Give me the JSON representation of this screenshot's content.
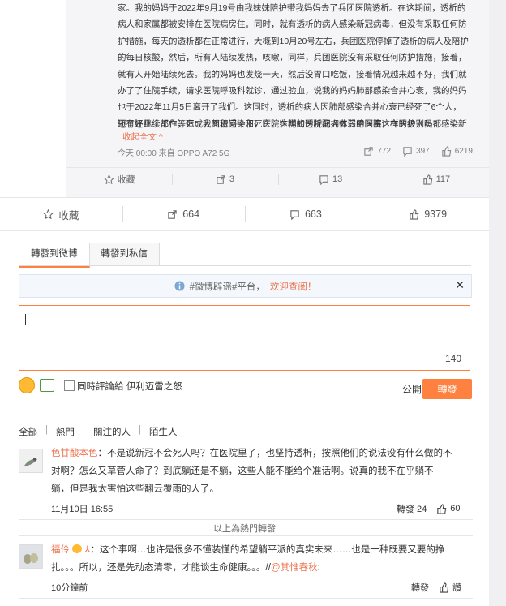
{
  "original_post": {
    "lines": [
      "家。我的妈妈于2022年9月19号由我妹妹陪护带我妈妈去了兵团医院透析。在这期间，透析的",
      "病人和家属都被安排在医院病房住。同时，就有透析的病人感染新冠病毒，但没有采取任何防",
      "护措施，每天的透析都在正常进行，大概到10月20号左右，兵团医院停掉了透析的病人及陪护",
      "的每日核酸，然后，所有人陆续发热，咳嗽，同样，兵团医院没有采取任何防护措施，接着，",
      "就有人开始陆续死去。我的妈妈也发烧一天，然后没胃口吃饭，接着情况越来越不好，我们就",
      "办了了住院手续，请求医院呼吸科就诊，通过验血，说我的妈妈肺部感染合并心衰，我的妈妈",
      "也于2022年11月5日离开了我们。这同时，透析的病人因肺部感染合并心衰已经死了6个人，",
      "还有好几个都在等死。我想请问一下，医院在明知透析病人体弱的同事，在医护人员都感染新",
      "冠了还继续工作，造成大面积感染和死亡，这样的医院配拥有三甲医院这样的级别吗?"
    ],
    "collapse_label": "收起全文 ^",
    "meta": "今天 00:00 来自 OPPO A72 5G",
    "repost_count": "772",
    "comment_count": "397",
    "like_count": "6219"
  },
  "inner_actions": {
    "favorite": "收藏",
    "repost": "3",
    "comment": "13",
    "like": "117"
  },
  "main_actions": {
    "favorite": "收藏",
    "repost": "664",
    "comment": "663",
    "like": "9379"
  },
  "compose": {
    "tab_weibo": "轉發到微博",
    "tab_private": "轉發到私信",
    "notice_prefix": "#微博辟谣#平台，",
    "notice_highlight": "欢迎查阅！",
    "char_count": "140",
    "also_comment_label": "同時評論給 伊利迈雷之怒",
    "visibility": "公開 ▾",
    "submit": "轉發"
  },
  "filters": {
    "all": "全部",
    "hot": "熱門",
    "following": "關注的人",
    "strangers": "陌生人"
  },
  "comments": [
    {
      "user": "色甘酸本色",
      "text_line1": "：不是说新冠不会死人吗？在医院里了，也坚持透析，按照他们的说法没有什么做的不",
      "text_line2": "对啊？怎么又草菅人命了？到底躺还是不躺，这些人能不能给个准话啊。说真的我不在乎躺不",
      "text_line3": "躺，但是我太害怕这些翻云覆雨的人了。",
      "time": "11月10日 16:55",
      "repost": "轉發 24",
      "like": "60"
    },
    {
      "user": "福伶",
      "text_line1": "：这个事啊…也许是很多不懂装懂的希望躺平派的真实未来……也是一种既要又要的挣",
      "text_line2": "扎。。。所以，还是先动态清零，才能谈生命健康。。。//",
      "mention": "@其惟春秋",
      "mention_tail": ":",
      "time": "10分鐘前",
      "repost": "轉發",
      "like": "讚"
    }
  ],
  "hot_label": "以上為熱門轉發"
}
